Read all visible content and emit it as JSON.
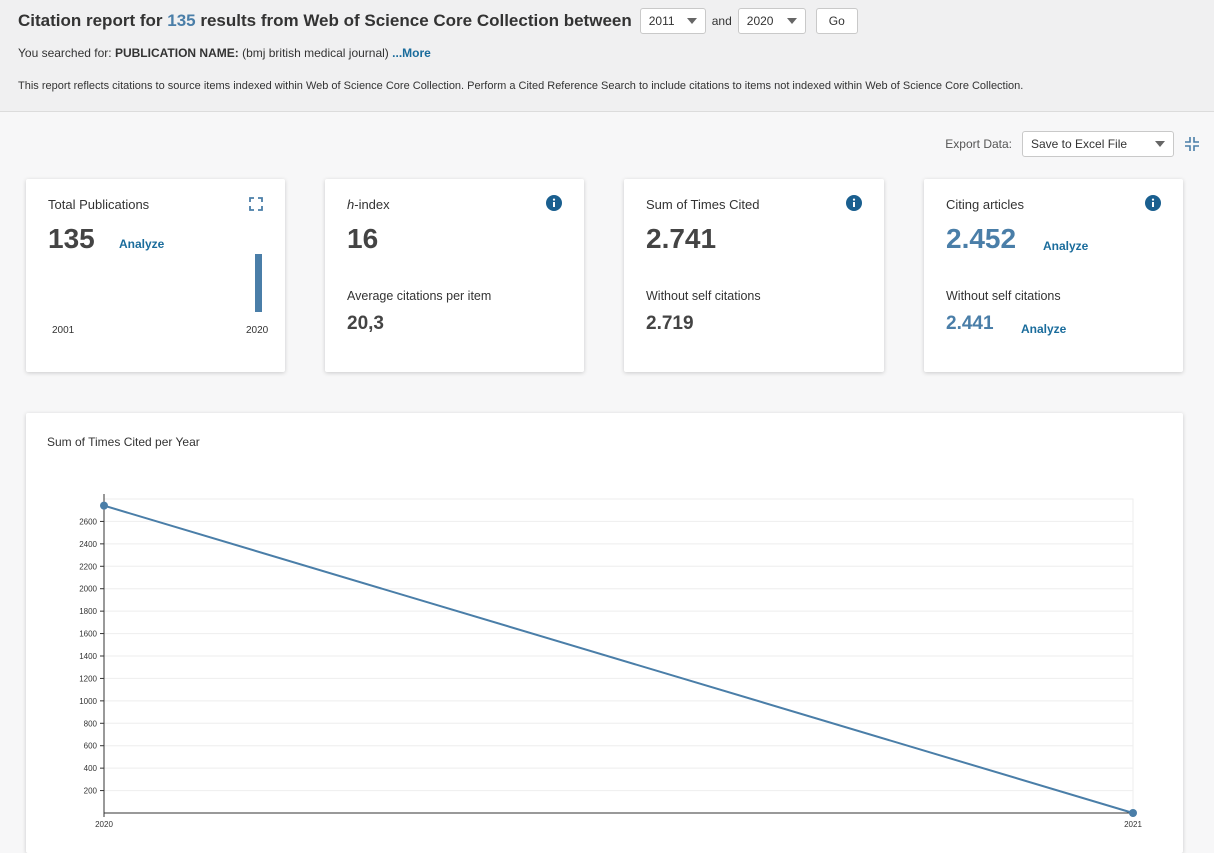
{
  "header": {
    "title_prefix": "Citation report for",
    "result_count": "135",
    "title_suffix": "results from Web of Science Core Collection between",
    "from_year": "2011",
    "and_label": "and",
    "to_year": "2020",
    "go_label": "Go",
    "searched_prefix": "You searched for:",
    "searched_field": "PUBLICATION NAME:",
    "searched_value": "(bmj british medical journal)",
    "more_label": "...More",
    "note": "This report reflects citations to source items indexed within Web of Science Core Collection. Perform a Cited Reference Search to include citations to items not indexed within Web of Science Core Collection."
  },
  "export": {
    "label": "Export Data:",
    "selected": "Save to Excel File"
  },
  "cards": {
    "total": {
      "title": "Total Publications",
      "value": "135",
      "analyze": "Analyze",
      "year_start": "2001",
      "year_end": "2020"
    },
    "hindex": {
      "title_italic": "h",
      "title_rest": "-index",
      "value": "16",
      "sub_title": "Average citations per item",
      "sub_value": "20,3"
    },
    "sum_cited": {
      "title": "Sum of Times Cited",
      "value": "2.741",
      "sub_title": "Without self citations",
      "sub_value": "2.719"
    },
    "citing": {
      "title": "Citing articles",
      "value": "2.452",
      "analyze": "Analyze",
      "sub_title": "Without self citations",
      "sub_value": "2.441",
      "sub_analyze": "Analyze"
    }
  },
  "colors": {
    "accent": "#4a7ea8",
    "link": "#1a6c9c",
    "info_icon": "#1a5f8f"
  },
  "chart_data": {
    "type": "line",
    "title": "Sum of Times Cited per Year",
    "x": [
      "2020",
      "2021"
    ],
    "series": [
      {
        "values": [
          2741,
          0
        ]
      }
    ],
    "yticks": [
      200,
      400,
      600,
      800,
      1000,
      1200,
      1400,
      1600,
      1800,
      2000,
      2200,
      2400,
      2600
    ],
    "ylim": [
      0,
      2800
    ],
    "grid": true
  }
}
